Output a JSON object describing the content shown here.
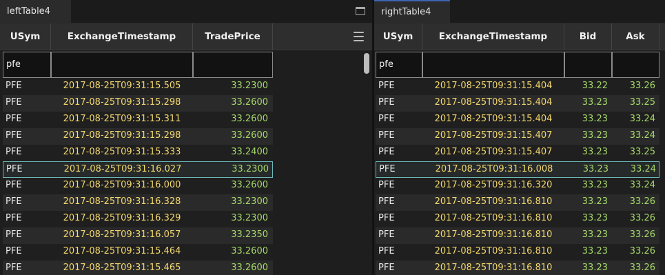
{
  "left": {
    "tab_label": "leftTable4",
    "columns": [
      "USym",
      "ExchangeTimestamp",
      "TradePrice"
    ],
    "filter": [
      "pfe",
      "",
      ""
    ],
    "rows": [
      [
        "PFE",
        "2017-08-25T09:31:15.505",
        "33.2300"
      ],
      [
        "PFE",
        "2017-08-25T09:31:15.298",
        "33.2600"
      ],
      [
        "PFE",
        "2017-08-25T09:31:15.311",
        "33.2600"
      ],
      [
        "PFE",
        "2017-08-25T09:31:15.298",
        "33.2600"
      ],
      [
        "PFE",
        "2017-08-25T09:31:15.333",
        "33.2400"
      ],
      [
        "PFE",
        "2017-08-25T09:31:16.027",
        "33.2300"
      ],
      [
        "PFE",
        "2017-08-25T09:31:16.000",
        "33.2600"
      ],
      [
        "PFE",
        "2017-08-25T09:31:16.328",
        "33.2300"
      ],
      [
        "PFE",
        "2017-08-25T09:31:16.329",
        "33.2300"
      ],
      [
        "PFE",
        "2017-08-25T09:31:16.057",
        "33.2350"
      ],
      [
        "PFE",
        "2017-08-25T09:31:15.464",
        "33.2600"
      ],
      [
        "PFE",
        "2017-08-25T09:31:15.465",
        "33.2600"
      ]
    ],
    "selected_row": 5
  },
  "right": {
    "tab_label": "rightTable4",
    "columns": [
      "USym",
      "ExchangeTimestamp",
      "Bid",
      "Ask"
    ],
    "filter": [
      "pfe",
      "",
      "",
      ""
    ],
    "rows": [
      [
        "PFE",
        "2017-08-25T09:31:15.404",
        "33.22",
        "33.26"
      ],
      [
        "PFE",
        "2017-08-25T09:31:15.404",
        "33.23",
        "33.25"
      ],
      [
        "PFE",
        "2017-08-25T09:31:15.404",
        "33.23",
        "33.24"
      ],
      [
        "PFE",
        "2017-08-25T09:31:15.407",
        "33.23",
        "33.24"
      ],
      [
        "PFE",
        "2017-08-25T09:31:15.407",
        "33.23",
        "33.25"
      ],
      [
        "PFE",
        "2017-08-25T09:31:16.008",
        "33.23",
        "33.24"
      ],
      [
        "PFE",
        "2017-08-25T09:31:16.320",
        "33.23",
        "33.24"
      ],
      [
        "PFE",
        "2017-08-25T09:31:16.810",
        "33.23",
        "33.26"
      ],
      [
        "PFE",
        "2017-08-25T09:31:16.810",
        "33.23",
        "33.26"
      ],
      [
        "PFE",
        "2017-08-25T09:31:16.810",
        "33.23",
        "33.26"
      ],
      [
        "PFE",
        "2017-08-25T09:31:16.810",
        "33.23",
        "33.26"
      ],
      [
        "PFE",
        "2017-08-25T09:31:16.810",
        "33.23",
        "33.26"
      ]
    ],
    "selected_row": 5
  },
  "colors": {
    "timestamp": "#f3d86e",
    "number": "#a6d86a",
    "selection_border": "#6cb7b7",
    "active_tab_accent": "#3f64b4"
  }
}
